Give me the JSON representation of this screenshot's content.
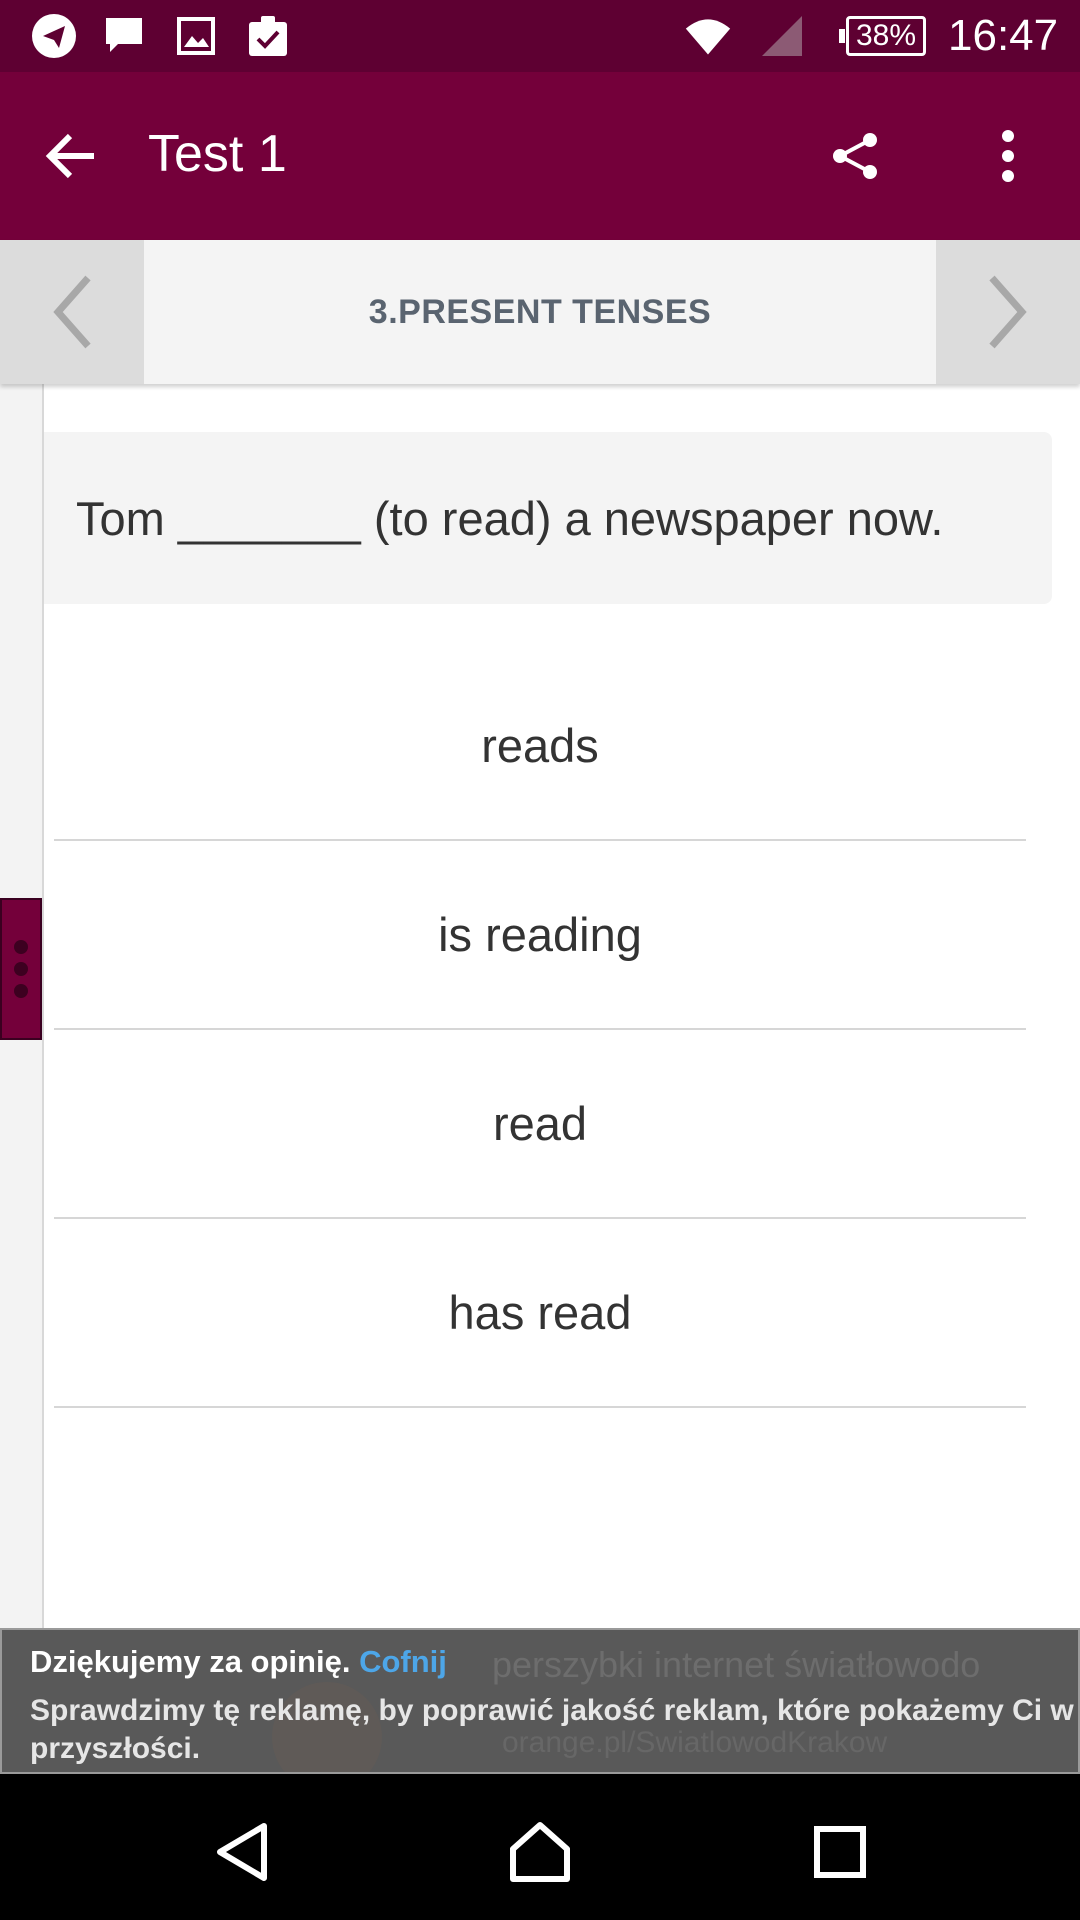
{
  "status_bar": {
    "battery": "38%",
    "time": "16:47",
    "icons": [
      "telegram-icon",
      "message-icon",
      "image-icon",
      "clipboard-check-icon",
      "wifi-icon",
      "signal-icon",
      "battery-icon"
    ]
  },
  "app_bar": {
    "title": "Test 1",
    "icons": [
      "arrow-left-icon",
      "share-icon",
      "more-vertical-icon"
    ]
  },
  "tab_header": {
    "title": "3.PRESENT TENSES",
    "icons": [
      "chevron-left-icon",
      "chevron-right-icon"
    ]
  },
  "question": {
    "text": "Tom _______ (to read) a newspaper now."
  },
  "answers": [
    "reads",
    "is reading",
    "read",
    "has read"
  ],
  "ad": {
    "thanks": "Dziękujemy za opinię.",
    "undo": "Cofnij",
    "message": "Sprawdzimy tę reklamę, by poprawić jakość reklam, które pokażemy Ci w przyszłości.",
    "background_text_1": "perszybki internet światłowodo",
    "background_text_2": "orange.pl/SwiatlowodKrakow"
  },
  "colors": {
    "status_bar": "#5e0032",
    "app_bar": "#74003a",
    "accent_link": "#4da6e8"
  }
}
